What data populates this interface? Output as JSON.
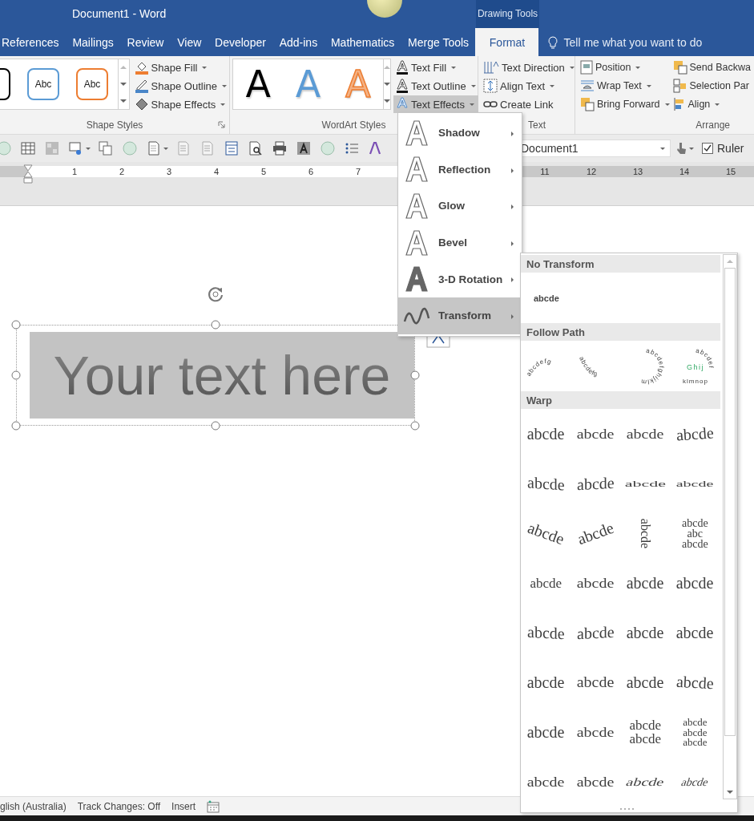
{
  "window": {
    "title": "Document1 - Word",
    "context_label": "Drawing Tools"
  },
  "tabs": [
    {
      "label": "References",
      "selected": false
    },
    {
      "label": "Mailings",
      "selected": false
    },
    {
      "label": "Review",
      "selected": false
    },
    {
      "label": "View",
      "selected": false
    },
    {
      "label": "Developer",
      "selected": false
    },
    {
      "label": "Add-ins",
      "selected": false
    },
    {
      "label": "Mathematics",
      "selected": false
    },
    {
      "label": "Merge Tools",
      "selected": false
    },
    {
      "label": "Format",
      "selected": true
    }
  ],
  "tell_me": {
    "placeholder": "Tell me what you want to do"
  },
  "ribbon": {
    "shape_styles": {
      "title": "Shape Styles",
      "samples": [
        {
          "color": "#000000"
        },
        {
          "text": "Abc",
          "color": "#5b9bd5"
        },
        {
          "text": "Abc",
          "color": "#ed7d31"
        }
      ],
      "commands": [
        {
          "label": "Shape Fill",
          "dropdown": true
        },
        {
          "label": "Shape Outline",
          "dropdown": true
        },
        {
          "label": "Shape Effects",
          "dropdown": true
        }
      ]
    },
    "wordart_styles": {
      "title": "WordArt Styles",
      "samples": [
        {
          "text": "A",
          "kind": "fill",
          "color": "#000000"
        },
        {
          "text": "A",
          "kind": "fill",
          "color": "#5b9bd5"
        },
        {
          "text": "A",
          "kind": "outline",
          "color": "#f4b183"
        }
      ],
      "commands": [
        {
          "label": "Text Fill",
          "dropdown": true,
          "expanded": false
        },
        {
          "label": "Text Outline",
          "dropdown": true,
          "expanded": false
        },
        {
          "label": "Text Effects",
          "dropdown": true,
          "expanded": true
        }
      ]
    },
    "text": {
      "title": "Text",
      "commands": [
        {
          "label": "Text Direction",
          "dropdown": true
        },
        {
          "label": "Align Text",
          "dropdown": true
        },
        {
          "label": "Create Link",
          "dropdown": false
        }
      ]
    },
    "arrange": {
      "title": "Arrange",
      "columns": [
        [
          {
            "label": "Position",
            "dropdown": true
          },
          {
            "label": "Wrap Text",
            "dropdown": true
          },
          {
            "label": "Bring Forward",
            "dropdown": true
          }
        ],
        [
          {
            "label": "Send Backwa",
            "dropdown": false
          },
          {
            "label": "Selection Par",
            "dropdown": false
          },
          {
            "label": "Align",
            "dropdown": true
          }
        ]
      ]
    }
  },
  "toolbar": {
    "document_select": {
      "value": "Document1"
    },
    "ruler_checkbox": {
      "label": "Ruler",
      "checked": true
    }
  },
  "ruler": {
    "left_numbers": [
      "1",
      "2",
      "3",
      "4",
      "5",
      "6",
      "7"
    ],
    "right_numbers": [
      "11",
      "12",
      "13",
      "14",
      "15"
    ]
  },
  "document": {
    "text_box": {
      "text": "Your text here",
      "selected": true
    }
  },
  "text_effects_menu": [
    {
      "label": "Shadow",
      "kind": "outline",
      "selected": false
    },
    {
      "label": "Reflection",
      "kind": "outline",
      "selected": false
    },
    {
      "label": "Glow",
      "kind": "outline",
      "selected": false
    },
    {
      "label": "Bevel",
      "kind": "outline",
      "selected": false
    },
    {
      "label": "3-D Rotation",
      "kind": "solid",
      "selected": false
    },
    {
      "label": "Transform",
      "kind": "wave",
      "selected": true
    }
  ],
  "transform_gallery": {
    "no_transform": {
      "title": "No Transform",
      "items": [
        "abcde"
      ]
    },
    "follow_path": {
      "title": "Follow Path",
      "items": [
        {
          "kind": "arch-up",
          "lines": [
            "abcdefg"
          ]
        },
        {
          "kind": "arch-down",
          "lines": [
            "abcdefg"
          ]
        },
        {
          "kind": "circle",
          "lines": [
            "abcdefghijklm"
          ]
        },
        {
          "kind": "button",
          "lines": [
            "abcdef",
            "Ghij",
            "klmnop"
          ]
        }
      ]
    },
    "warp": {
      "title": "Warp",
      "items": [
        {
          "lines": [
            "abcde"
          ]
        },
        {
          "lines": [
            "abcde"
          ]
        },
        {
          "lines": [
            "abcde"
          ]
        },
        {
          "lines": [
            "abcde"
          ]
        },
        {
          "lines": [
            "abcde"
          ]
        },
        {
          "lines": [
            "abcde"
          ]
        },
        {
          "lines": [
            "abcde"
          ]
        },
        {
          "lines": [
            "abcde"
          ]
        },
        {
          "lines": [
            "abcde"
          ]
        },
        {
          "lines": [
            "abcde"
          ]
        },
        {
          "lines": [
            "abcde"
          ]
        },
        {
          "lines": [
            "abcde",
            "abc",
            "abcde"
          ]
        },
        {
          "lines": [
            "abcde"
          ]
        },
        {
          "lines": [
            "abcde"
          ]
        },
        {
          "lines": [
            "abcde"
          ]
        },
        {
          "lines": [
            "abcde"
          ]
        },
        {
          "lines": [
            "abcde"
          ]
        },
        {
          "lines": [
            "abcde"
          ]
        },
        {
          "lines": [
            "abcde"
          ]
        },
        {
          "lines": [
            "abcde"
          ]
        },
        {
          "lines": [
            "abcde"
          ]
        },
        {
          "lines": [
            "abcde"
          ]
        },
        {
          "lines": [
            "abcde"
          ]
        },
        {
          "lines": [
            "abcde"
          ]
        },
        {
          "lines": [
            "abcde"
          ]
        },
        {
          "lines": [
            "abcde"
          ]
        },
        {
          "lines": [
            "abcde",
            "abcde"
          ]
        },
        {
          "lines": [
            "abcde",
            "abcde",
            "abcde"
          ]
        },
        {
          "lines": [
            "abcde"
          ]
        },
        {
          "lines": [
            "abcde"
          ]
        },
        {
          "lines": [
            "abcde"
          ]
        },
        {
          "lines": [
            "abcde"
          ]
        }
      ]
    }
  },
  "status_bar": [
    "glish (Australia)",
    "Track Changes: Off",
    "Insert"
  ]
}
